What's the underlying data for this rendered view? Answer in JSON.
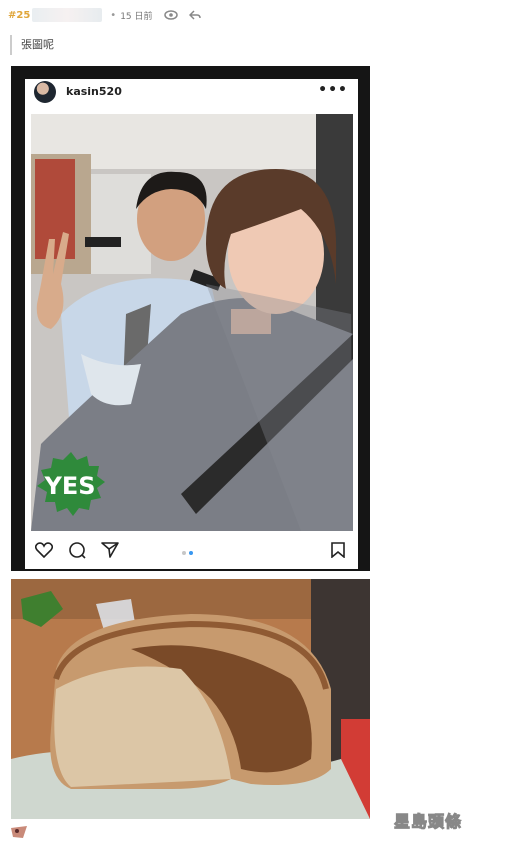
{
  "post": {
    "floor": "#25",
    "time": "15 日前"
  },
  "quote": {
    "text": "張圖呢"
  },
  "instagram": {
    "username": "kasin520",
    "more": "•••",
    "badge_text": "YES"
  },
  "watermark": {
    "text": "星島頭條"
  }
}
